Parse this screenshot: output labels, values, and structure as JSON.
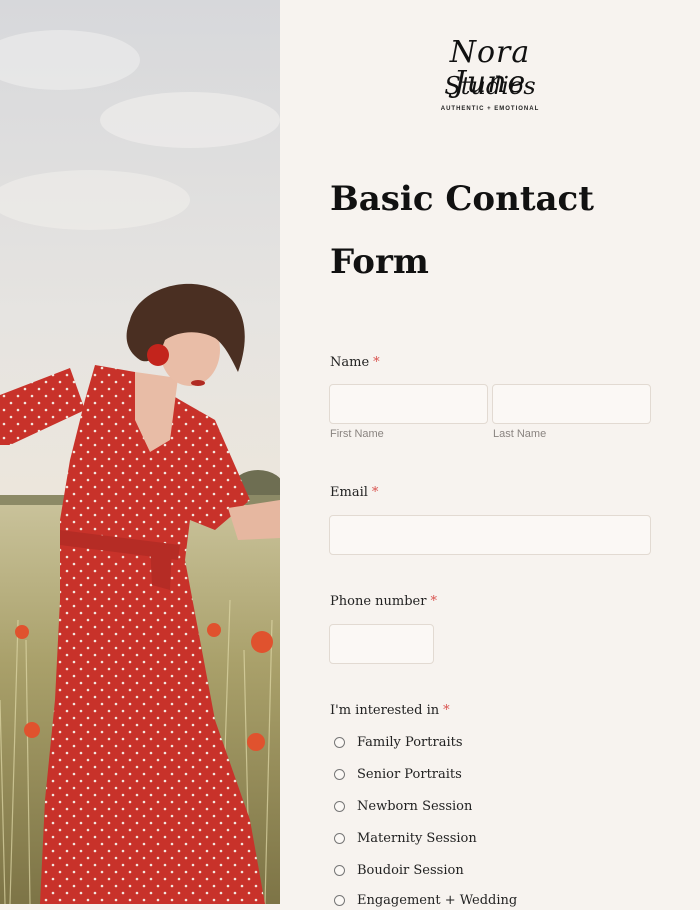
{
  "logo": {
    "line1": "Nora June",
    "line2": "Studios",
    "tagline": "AUTHENTIC + EMOTIONAL"
  },
  "form": {
    "title": "Basic Contact Form",
    "required_marker": "*",
    "name": {
      "label": "Name",
      "first_sublabel": "First Name",
      "last_sublabel": "Last Name",
      "first_value": "",
      "last_value": ""
    },
    "email": {
      "label": "Email",
      "value": ""
    },
    "phone": {
      "label": "Phone number",
      "value": ""
    },
    "interest": {
      "label": "I'm interested in",
      "options": [
        "Family Portraits",
        "Senior Portraits",
        "Newborn Session",
        "Maternity Session",
        "Boudoir Session",
        "Engagement + Wedding"
      ]
    }
  },
  "colors": {
    "background": "#f7f3ef",
    "input_background": "#fbf8f5",
    "required": "#d9534f",
    "dress": "#c8322a"
  },
  "photo": {
    "description_icon": "woman-in-red-dress-photo"
  }
}
